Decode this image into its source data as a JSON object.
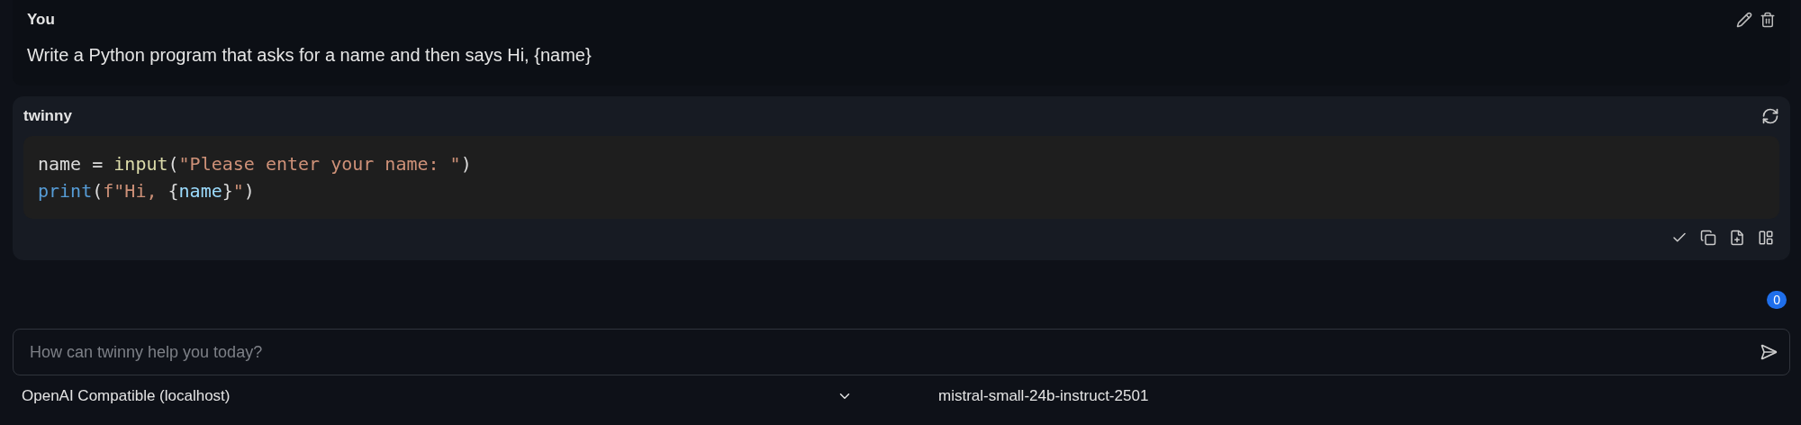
{
  "user_message": {
    "author": "You",
    "text": "Write a Python program that asks for a name and then says Hi, {name}"
  },
  "reply": {
    "author": "twinny",
    "code_lines": [
      [
        {
          "kind": "plain",
          "text": "name = "
        },
        {
          "kind": "func",
          "text": "input"
        },
        {
          "kind": "plain",
          "text": "("
        },
        {
          "kind": "string",
          "text": "\"Please enter your name: \""
        },
        {
          "kind": "plain",
          "text": ")"
        }
      ],
      [
        {
          "kind": "builtin",
          "text": "print"
        },
        {
          "kind": "plain",
          "text": "("
        },
        {
          "kind": "string",
          "text": "f\"Hi, "
        },
        {
          "kind": "plain",
          "text": "{"
        },
        {
          "kind": "variable",
          "text": "name"
        },
        {
          "kind": "plain",
          "text": "}"
        },
        {
          "kind": "string",
          "text": "\""
        },
        {
          "kind": "plain",
          "text": ")"
        }
      ]
    ]
  },
  "badge": {
    "count": "0"
  },
  "prompt": {
    "placeholder": "How can twinny help you today?"
  },
  "footer": {
    "provider": "OpenAI Compatible (localhost)",
    "model": "mistral-small-24b-instruct-2501"
  }
}
